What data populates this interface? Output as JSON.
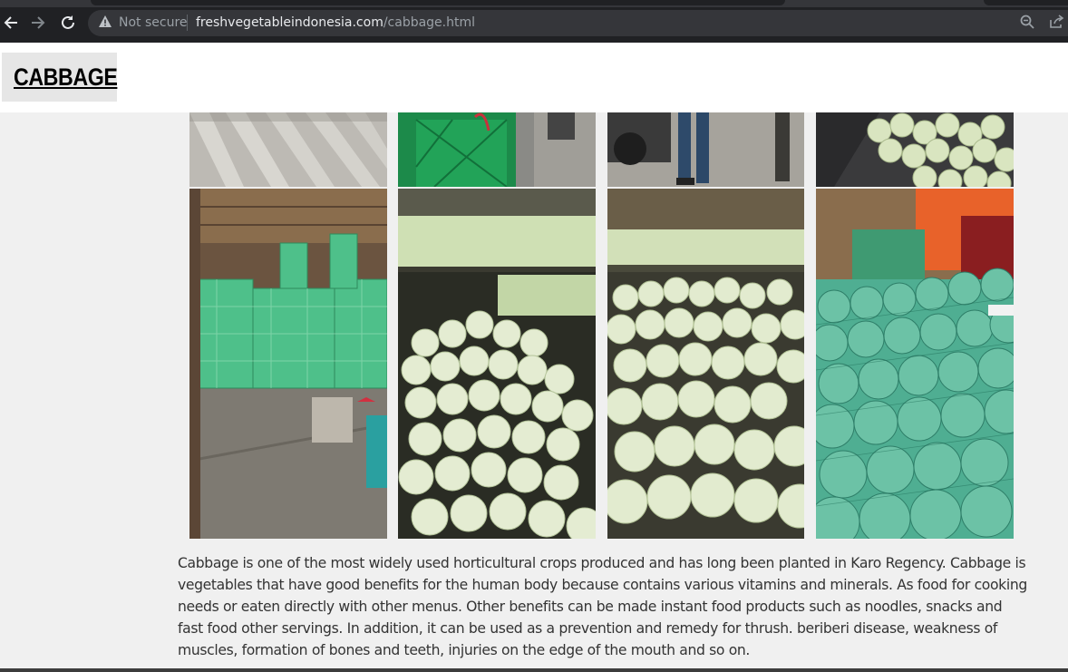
{
  "browser": {
    "security_label": "Not secure",
    "url_host": "freshvegetableindonesia.com",
    "url_path": "/cabbage.html",
    "icons": [
      "back-arrow-icon",
      "forward-arrow-icon",
      "reload-icon",
      "warning-icon",
      "zoom-icon",
      "share-icon"
    ]
  },
  "page": {
    "logo_text": "CABBAGE",
    "description": "Cabbage is one of the most widely used horticultural crops produced and has long been planted in Karo Regency. Cabbage is vegetables that have good benefits for the human body because contains various vitamins and minerals. As food for cooking needs or eaten directly with other menus. Other benefits can be made instant food products such as noodles, snacks and fast food other servings. In addition, it can be used as a prevention and remedy for thrush. beriberi disease, weakness of muscles, formation of bones and teeth, injuries on the edge of the mouth and so on."
  },
  "colors": {
    "chrome_bg": "#202124",
    "omnibox_bg": "#35363a",
    "page_bg": "#f0f0f0",
    "text": "#333333"
  }
}
